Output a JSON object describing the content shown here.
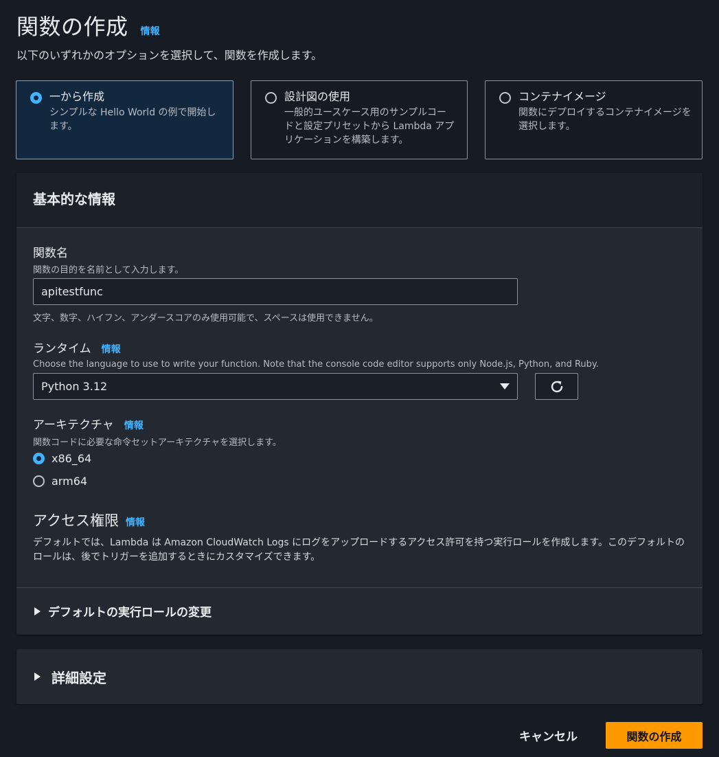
{
  "header": {
    "title": "関数の作成",
    "info": "情報",
    "subtitle": "以下のいずれかのオプションを選択して、関数を作成します。"
  },
  "options": [
    {
      "title": "一から作成",
      "desc": "シンプルな Hello World の例で開始します。",
      "selected": true
    },
    {
      "title": "設計図の使用",
      "desc": "一般的ユースケース用のサンプルコードと設定プリセットから Lambda アプリケーションを構築します。",
      "selected": false
    },
    {
      "title": "コンテナイメージ",
      "desc": "関数にデプロイするコンテナイメージを選択します。",
      "selected": false
    }
  ],
  "basic": {
    "title": "基本的な情報",
    "function_name": {
      "label": "関数名",
      "desc": "関数の目的を名前として入力します。",
      "value": "apitestfunc",
      "constraint": "文字、数字、ハイフン、アンダースコアのみ使用可能で、スペースは使用できません。"
    },
    "runtime": {
      "label": "ランタイム",
      "info": "情報",
      "desc": "Choose the language to use to write your function. Note that the console code editor supports only Node.js, Python, and Ruby.",
      "value": "Python 3.12"
    },
    "architecture": {
      "label": "アーキテクチャ",
      "info": "情報",
      "desc": "関数コードに必要な命令セットアーキテクチャを選択します。",
      "options": [
        "x86_64",
        "arm64"
      ],
      "selected": "x86_64"
    },
    "permissions": {
      "label": "アクセス権限",
      "info": "情報",
      "desc": "デフォルトでは、Lambda は Amazon CloudWatch Logs にログをアップロードするアクセス許可を持つ実行ロールを作成します。このデフォルトのロールは、後でトリガーを追加するときにカスタマイズできます。"
    },
    "role_expander": "デフォルトの実行ロールの変更"
  },
  "advanced": {
    "label": "詳細設定"
  },
  "footer": {
    "cancel": "キャンセル",
    "create": "関数の作成"
  },
  "colors": {
    "accent": "#42b4ff",
    "primary_button": "#ff9900",
    "background": "#171b24",
    "panel": "#232831"
  }
}
